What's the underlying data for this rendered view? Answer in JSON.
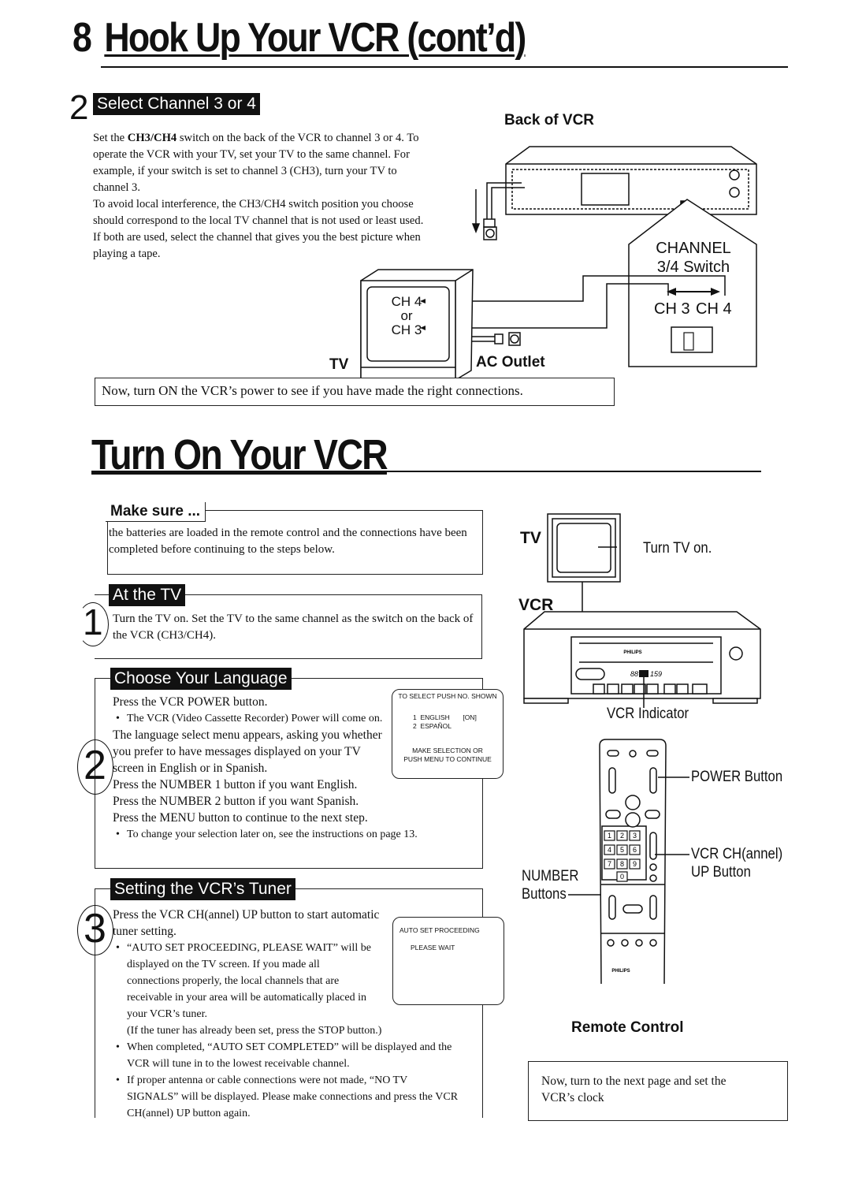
{
  "page": {
    "number": "8",
    "title": "Hook Up Your VCR (cont’d)"
  },
  "step2_select": {
    "step_number": "2",
    "heading": "Select Channel 3 or 4",
    "paragraphs": [
      "Set the CH3/CH4 switch on the back of the VCR to channel 3 or 4. To operate the VCR with your TV, set your TV to the same channel. For example, if your switch is set to channel 3 (CH3), turn your TV to channel 3.",
      "To avoid local interference, the CH3/CH4 switch position you choose should correspond to the local TV channel that is not used or least used.",
      "If both are used, select the channel that gives you the best picture when playing a tape."
    ],
    "bold_term": "CH3/CH4",
    "p1_rest": " switch on the back of the VCR to channel 3 or 4. To operate the VCR with your TV, set your TV to the same channel. For example, if your switch is set to channel 3 (CH3), turn your TV to channel 3.",
    "p1_prefix": "Set the "
  },
  "diagram_hookup": {
    "back_of_vcr_label": "Back of VCR",
    "channel_switch_label_line1": "CHANNEL",
    "channel_switch_label_line2": "3/4 Switch",
    "ch3_label": "CH 3",
    "ch4_label": "CH 4",
    "tv_screen_ch4": "CH 4",
    "tv_screen_or": "or",
    "tv_screen_ch3": "CH 3",
    "tv_label": "TV",
    "ac_outlet_label": "AC Outlet"
  },
  "power_note": "Now, turn ON the VCR’s power to see if you have made the right connections.",
  "section2": {
    "title": "Turn On Your VCR"
  },
  "make_sure": {
    "heading": "Make sure ...",
    "text": "the batteries are loaded in the remote control and the connections have been completed before continuing to the steps below."
  },
  "step1": {
    "number": "1",
    "heading": "At the TV",
    "text": "Turn the TV on. Set the TV to the same channel as the switch on the back of the VCR (CH3/CH4)."
  },
  "step2": {
    "number": "2",
    "heading": "Choose Your Language",
    "lines": [
      "Press the VCR POWER button.",
      "The language select menu appears, asking you whether you prefer to have messages displayed on your TV screen in English or in Spanish.",
      "Press the NUMBER 1 button if you want English.",
      "Press the NUMBER 2 button if you want Spanish.",
      "Press the MENU button to continue to the next step."
    ],
    "bullet_power": "The VCR (Video Cassette Recorder) Power will come on.",
    "bullet_change": "To change your selection later on, see the instructions on page 13.",
    "screen": {
      "header": "TO SELECT PUSH NO. SHOWN",
      "option1_num": "1",
      "option1_label": "ENGLISH",
      "option1_state": "[ON]",
      "option2_num": "2",
      "option2_label": "ESPAÑOL",
      "footer_line1": "MAKE SELECTION OR",
      "footer_line2": "PUSH MENU TO CONTINUE"
    }
  },
  "step3": {
    "number": "3",
    "heading": "Setting the VCR’s Tuner",
    "intro": "Press the VCR CH(annel) UP button to start automatic tuner setting.",
    "bullets": [
      "“AUTO SET PROCEEDING, PLEASE WAIT” will be displayed on the TV screen. If you made all connections properly, the local channels that are receivable in your area will be automatically placed in your VCR’s tuner.",
      "When completed, “AUTO SET COMPLETED” will be displayed and the VCR will tune in to the lowest receivable channel.",
      "If proper antenna or cable connections were not made, “NO TV SIGNALS” will be displayed. Please make connections and press the VCR CH(annel) UP button again."
    ],
    "note": "(If the tuner has already been set, press the STOP button.)",
    "screen": {
      "line1": "AUTO SET PROCEEDING",
      "line2": "PLEASE WAIT"
    }
  },
  "diagram_turnon": {
    "tv_label": "TV",
    "turn_tv_on": "Turn TV on.",
    "vcr_label": "VCR",
    "vcr_brand": "PHILIPS",
    "vcr_display": "88 88 159",
    "vcr_indicator": "VCR Indicator",
    "power_button": "POWER Button",
    "ch_up_line1": "VCR CH(annel)",
    "ch_up_line2": "UP Button",
    "number_line1": "NUMBER",
    "number_line2": "Buttons",
    "remote_brand": "PHILIPS",
    "remote_keys": [
      "1",
      "2",
      "3",
      "4",
      "5",
      "6",
      "7",
      "8",
      "9",
      "0"
    ],
    "remote_caption": "Remote Control"
  },
  "next_note": "Now, turn to the next page and set the VCR’s clock"
}
